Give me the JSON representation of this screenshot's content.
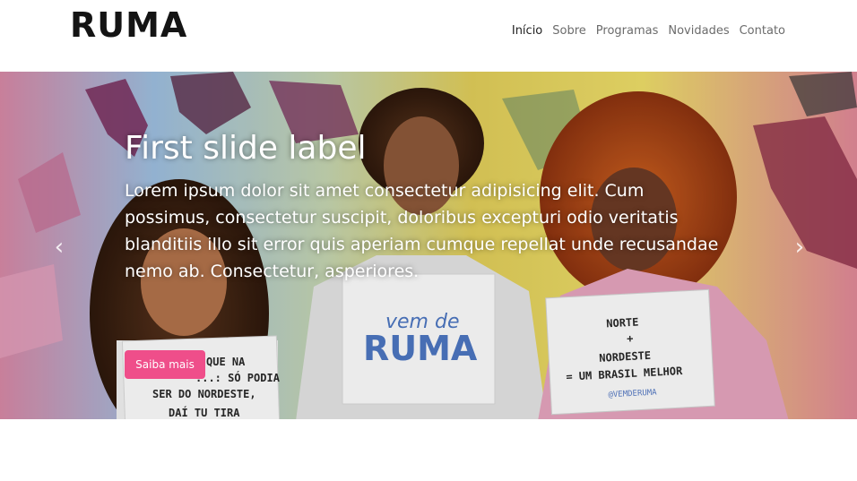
{
  "brand": {
    "logo_text": "RUMA"
  },
  "nav": {
    "items": [
      {
        "label": "Início",
        "active": true
      },
      {
        "label": "Sobre",
        "active": false
      },
      {
        "label": "Programas",
        "active": false
      },
      {
        "label": "Novidades",
        "active": false
      },
      {
        "label": "Contato",
        "active": false
      }
    ]
  },
  "hero": {
    "title": "First slide label",
    "text": "Lorem ipsum dolor sit amet consectetur adipisicing elit. Cum possimus, consectetur suscipit, doloribus excepturi odio veritatis blanditiis illo sit error quis aperiam cumque repellat unde recusandae nemo ab. Consectetur, asperiores.",
    "button_label": "Saiba mais",
    "prev_icon": "chevron-left-icon",
    "next_icon": "chevron-right-icon",
    "accent_color": "#ef4e8a",
    "signs": {
      "left": [
        "QUE NA",
        "...: SÓ PODIA",
        "SER DO NORDESTE,",
        "DAÍ TU TIRA"
      ],
      "center": [
        "vem de",
        "RUMA"
      ],
      "right": [
        "NORTE",
        "+",
        "NORDESTE",
        "= UM BRASIL MELHOR",
        "@VEMDERUMA"
      ]
    }
  }
}
